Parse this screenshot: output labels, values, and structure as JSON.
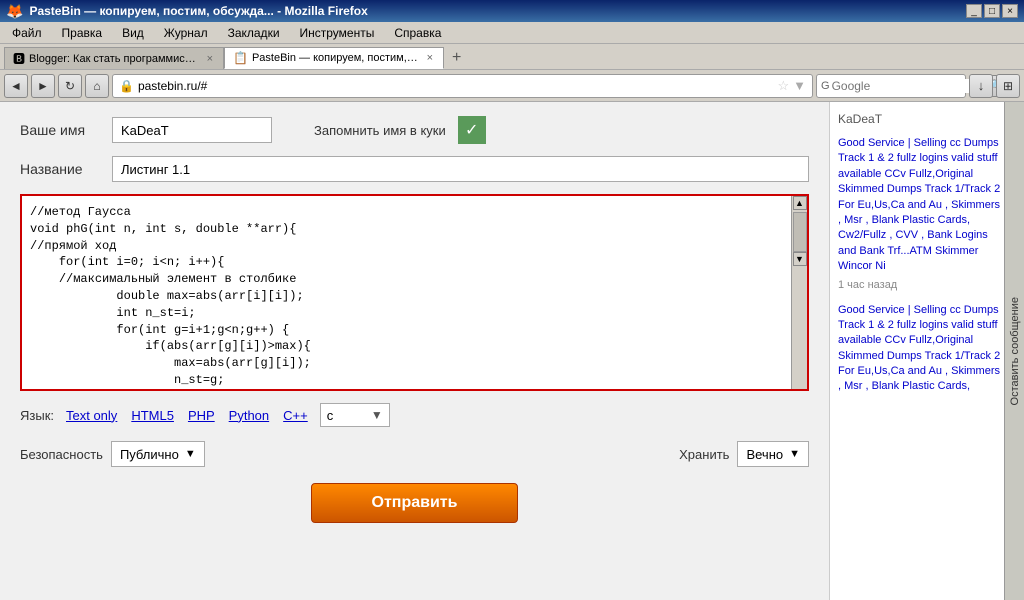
{
  "window": {
    "title": "PasteBin — копируем, постим, обсужда... - Mozilla Firefox",
    "controls": {
      "minimize": "_",
      "maximize": "□",
      "close": "×"
    }
  },
  "menubar": {
    "items": [
      "Файл",
      "Правка",
      "Вид",
      "Журнал",
      "Закладки",
      "Инструменты",
      "Справка"
    ]
  },
  "tabs": [
    {
      "id": "tab1",
      "label": "Blogger: Как стать программистом – Но...",
      "active": false,
      "icon": "blogger-icon"
    },
    {
      "id": "tab2",
      "label": "PasteBin — копируем, постим, обсужда...",
      "active": true,
      "icon": "pastebin-icon"
    }
  ],
  "tab_new_label": "+",
  "navbar": {
    "back": "◄",
    "forward": "►",
    "reload": "↻",
    "home": "⌂",
    "address": "pastebin.ru/#",
    "search_placeholder": "Google",
    "search_label": "Google",
    "download": "↓"
  },
  "form": {
    "name_label": "Ваше имя",
    "name_value": "KaDeaT",
    "name_placeholder": "KaDeaT",
    "remember_label": "Запомнить имя в куки",
    "checkmark": "✓",
    "title_label": "Название",
    "title_value": "Листинг 1.1",
    "code_content": "//метод Гаусса\nvoid phG(int n, int s, double **arr){\n//прямой ход\n    for(int i=0; i<n; i++){\n    //максимальный элемент в столбике\n            double max=abs(arr[i][i]);\n            int n_st=i;\n            for(int g=i+1;g<n;g++) {\n                if(abs(arr[g][i])>max){\n                    max=abs(arr[g][i]);\n                    n_st=g;\n                }",
    "lang_label": "Язык:",
    "lang_options": [
      "Text only",
      "HTML5",
      "PHP",
      "Python",
      "C++"
    ],
    "lang_selected": "c",
    "lang_dropdown_arrow": "▼",
    "security_label": "Безопасность",
    "security_value": "Публично",
    "security_arrow": "▼",
    "store_label": "Хранить",
    "store_value": "Вечно",
    "store_arrow": "▼",
    "submit_label": "Отправить"
  },
  "sidebar": {
    "username": "KaDeaT",
    "ads": [
      {
        "text": "Good Service | Selling cc Dumps Track 1 & 2 fullz logins valid stuff available CCv Fullz,Original Skimmed Dumps Track 1/Track 2 For Eu,Us,Ca and Au , Skimmers , Msr , Blank Plastic Cards, Cw2/Fullz , CVV , Bank Logins and Bank Trf...ATM Skimmer Wincor Ni",
        "time": "1 час назад"
      },
      {
        "text": "Good Service | Selling cc Dumps Track 1 & 2 fullz logins valid stuff available CCv Fullz,Original Skimmed Dumps Track 1/Track 2 For Eu,Us,Ca and Au , Skimmers , Msr , Blank Plastic Cards,",
        "time": ""
      }
    ],
    "side_tab_label": "Оставить сообщение"
  }
}
